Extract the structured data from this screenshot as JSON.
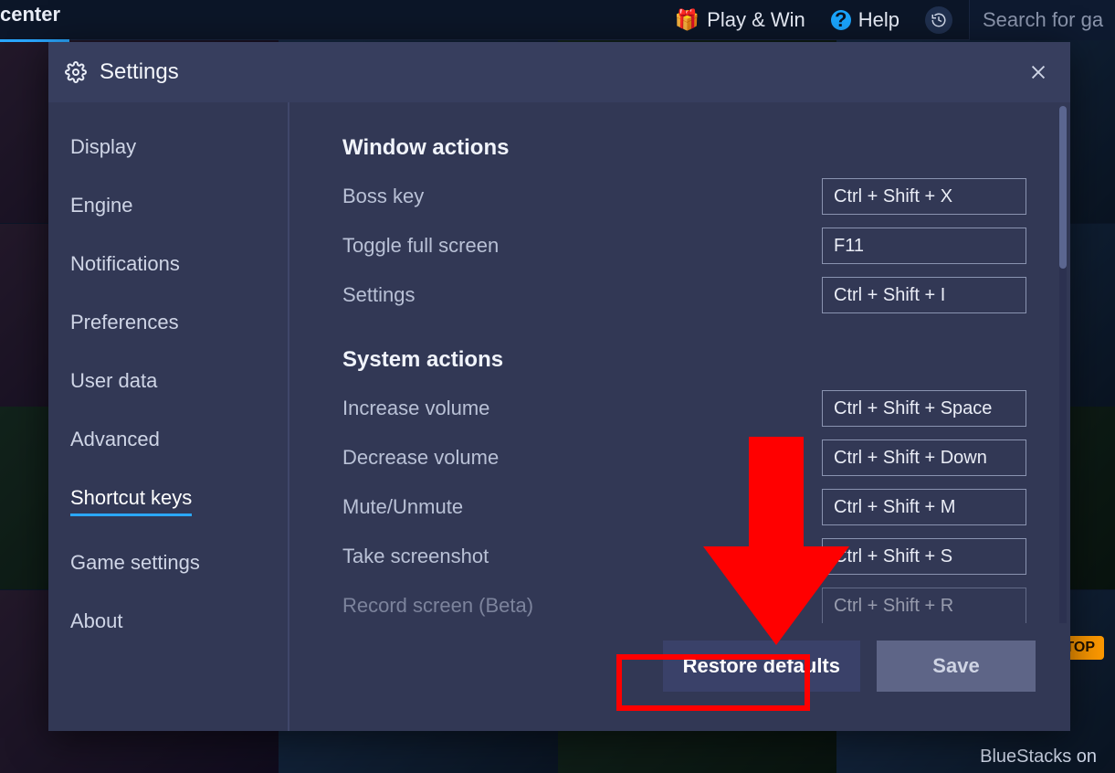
{
  "topbar": {
    "brand": "center",
    "play_win": "Play & Win",
    "help": "Help",
    "search_placeholder": "Search for ga"
  },
  "modal": {
    "title": "Settings"
  },
  "sidebar": {
    "items": [
      {
        "label": "Display"
      },
      {
        "label": "Engine"
      },
      {
        "label": "Notifications"
      },
      {
        "label": "Preferences"
      },
      {
        "label": "User data"
      },
      {
        "label": "Advanced"
      },
      {
        "label": "Shortcut keys"
      },
      {
        "label": "Game settings"
      },
      {
        "label": "About"
      }
    ],
    "active_index": 6
  },
  "content": {
    "sections": [
      {
        "title": "Window actions",
        "rows": [
          {
            "label": "Boss key",
            "value": "Ctrl + Shift + X"
          },
          {
            "label": "Toggle full screen",
            "value": "F11"
          },
          {
            "label": "Settings",
            "value": "Ctrl + Shift + I"
          }
        ]
      },
      {
        "title": "System actions",
        "rows": [
          {
            "label": "Increase volume",
            "value": "Ctrl + Shift + Space"
          },
          {
            "label": "Decrease volume",
            "value": "Ctrl + Shift + Down"
          },
          {
            "label": "Mute/Unmute",
            "value": "Ctrl + Shift + M"
          },
          {
            "label": "Take screenshot",
            "value": "Ctrl + Shift + S"
          },
          {
            "label": "Record screen (Beta)",
            "value": "Ctrl + Shift + R"
          }
        ]
      }
    ]
  },
  "footer": {
    "restore": "Restore defaults",
    "save": "Save"
  },
  "bg": {
    "bottom_text": "BlueStacks on",
    "top_badge": "TOP"
  }
}
